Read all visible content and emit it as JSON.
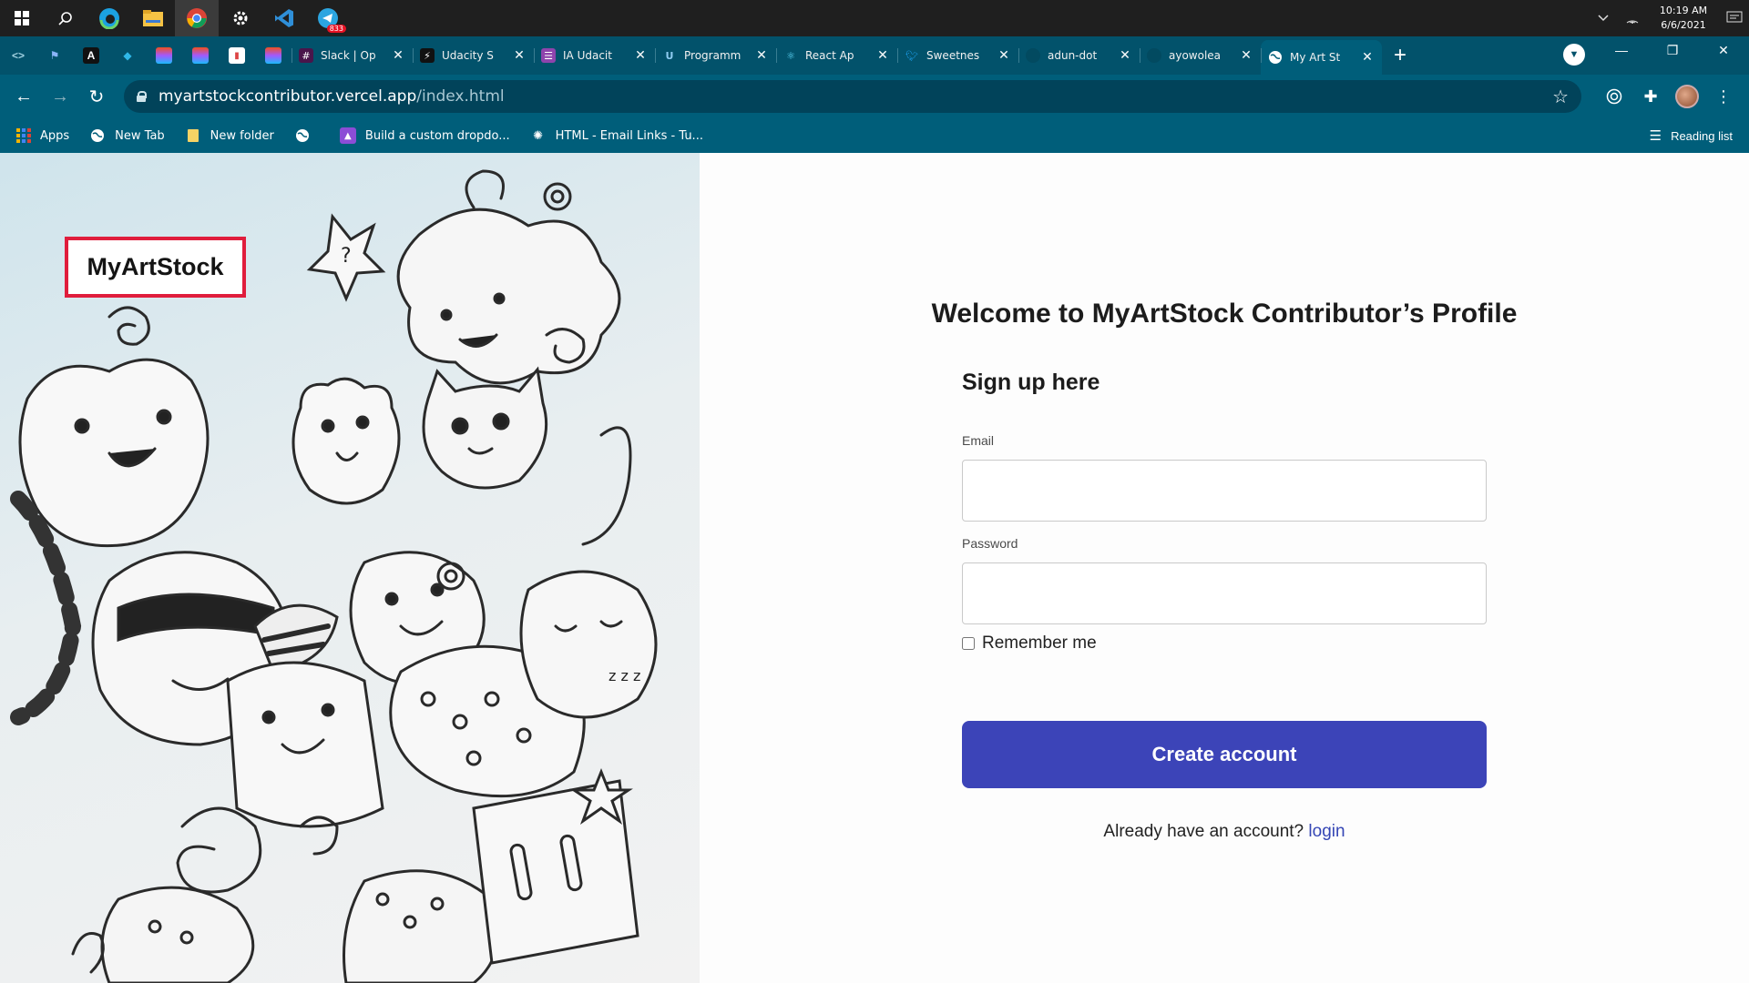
{
  "taskbar": {
    "icons": [
      "windows-start",
      "search",
      "edge",
      "file-explorer",
      "chrome",
      "settings",
      "vscode",
      "telegram"
    ],
    "telegram_badge": "833",
    "clock_time": "10:19 AM",
    "clock_date": "6/6/2021"
  },
  "browser": {
    "tabs": [
      {
        "label": "Slack | Op",
        "favicon": "slack"
      },
      {
        "label": "Udacity S",
        "favicon": "udacity"
      },
      {
        "label": "IA Udacit",
        "favicon": "ia"
      },
      {
        "label": "Programm",
        "favicon": "udacity-u"
      },
      {
        "label": "React Ap",
        "favicon": "react"
      },
      {
        "label": "Sweetnes",
        "favicon": "twitter"
      },
      {
        "label": "adun-dot",
        "favicon": "github"
      },
      {
        "label": "ayowolea",
        "favicon": "github"
      },
      {
        "label": "My Art St",
        "favicon": "globe",
        "active": true
      }
    ],
    "url_host": "myartstockcontributor.vercel.app",
    "url_path": "/index.html",
    "bookmarks": [
      {
        "label": "Apps",
        "icon": "apps-grid"
      },
      {
        "label": "New Tab",
        "icon": "globe"
      },
      {
        "label": "New folder",
        "icon": "folder"
      },
      {
        "label": "",
        "icon": "globe"
      },
      {
        "label": "Build a custom dropdo...",
        "icon": "site"
      },
      {
        "label": "HTML - Email Links - Tu...",
        "icon": "site"
      }
    ],
    "reading_list": "Reading list"
  },
  "page": {
    "brand": "MyArtStock",
    "welcome": "Welcome to MyArtStock Contributor’s Profile",
    "signup_heading": "Sign up here",
    "email_label": "Email",
    "email_value": "",
    "password_label": "Password",
    "password_value": "",
    "remember_label": "Remember me",
    "create_button": "Create account",
    "have_account": "Already have an account?",
    "login_link": "login"
  },
  "colors": {
    "taskbar": "#1f1f1f",
    "chrome_frame": "#02526b",
    "brand_border": "#e01d3c",
    "cta": "#3c44b8",
    "link": "#3546b5"
  }
}
